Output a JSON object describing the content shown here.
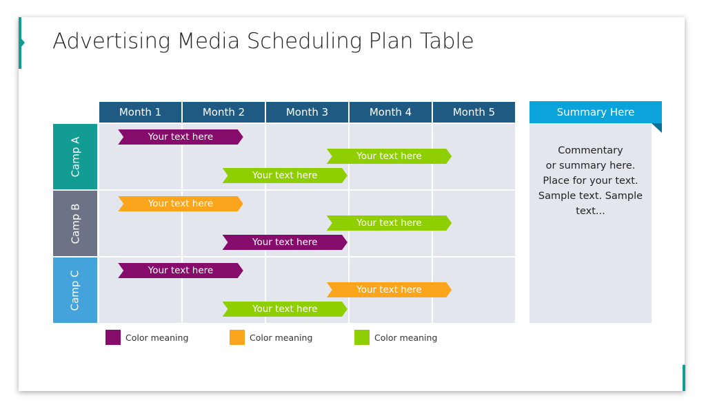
{
  "title": "Advertising Media Scheduling Plan Table",
  "months": [
    "Month 1",
    "Month 2",
    "Month 3",
    "Month 4",
    "Month 5"
  ],
  "camps": [
    {
      "label": "Camp A",
      "color": "#139c94"
    },
    {
      "label": "Camp B",
      "color": "#6b7385"
    },
    {
      "label": "Camp C",
      "color": "#45a3dc"
    }
  ],
  "colors": {
    "purple": "#850c6a",
    "orange": "#fba51c",
    "green": "#8fce00",
    "header": "#1e5a82",
    "summary": "#0aa3dc",
    "accent": "#139c94"
  },
  "bars": [
    {
      "camp": 0,
      "row": 0,
      "start_month": 0.25,
      "end_month": 1.75,
      "color": "purple",
      "label": "Your text here"
    },
    {
      "camp": 0,
      "row": 1,
      "start_month": 2.75,
      "end_month": 4.25,
      "color": "green",
      "label": "Your text here"
    },
    {
      "camp": 0,
      "row": 2,
      "start_month": 1.5,
      "end_month": 3.0,
      "color": "green",
      "label": "Your text here"
    },
    {
      "camp": 1,
      "row": 0,
      "start_month": 0.25,
      "end_month": 1.75,
      "color": "orange",
      "label": "Your text here"
    },
    {
      "camp": 1,
      "row": 1,
      "start_month": 2.75,
      "end_month": 4.25,
      "color": "green",
      "label": "Your text here"
    },
    {
      "camp": 1,
      "row": 2,
      "start_month": 1.5,
      "end_month": 3.0,
      "color": "purple",
      "label": "Your text here"
    },
    {
      "camp": 2,
      "row": 0,
      "start_month": 0.25,
      "end_month": 1.75,
      "color": "purple",
      "label": "Your text here"
    },
    {
      "camp": 2,
      "row": 1,
      "start_month": 2.75,
      "end_month": 4.25,
      "color": "orange",
      "label": "Your text here"
    },
    {
      "camp": 2,
      "row": 2,
      "start_month": 1.5,
      "end_month": 3.0,
      "color": "green",
      "label": "Your text here"
    }
  ],
  "summary": {
    "heading": "Summary Here",
    "lines": [
      "Commentary",
      "or summary here.",
      "Place for your text.",
      "Sample text. Sample",
      "text..."
    ]
  },
  "legend": [
    {
      "color": "purple",
      "label": "Color meaning"
    },
    {
      "color": "orange",
      "label": "Color meaning"
    },
    {
      "color": "green",
      "label": "Color meaning"
    }
  ]
}
